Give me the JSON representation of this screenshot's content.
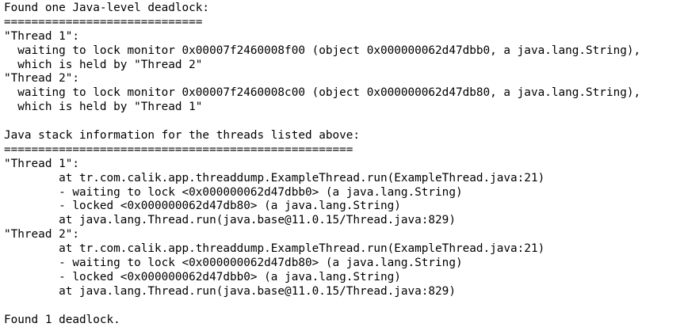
{
  "terminal": {
    "lines": [
      "Found one Java-level deadlock:",
      "=============================",
      "\"Thread 1\":",
      "  waiting to lock monitor 0x00007f2460008f00 (object 0x000000062d47dbb0, a java.lang.String),",
      "  which is held by \"Thread 2\"",
      "\"Thread 2\":",
      "  waiting to lock monitor 0x00007f2460008c00 (object 0x000000062d47db80, a java.lang.String),",
      "  which is held by \"Thread 1\"",
      "",
      "Java stack information for the threads listed above:",
      "===================================================",
      "\"Thread 1\":",
      "        at tr.com.calik.app.threaddump.ExampleThread.run(ExampleThread.java:21)",
      "        - waiting to lock <0x000000062d47dbb0> (a java.lang.String)",
      "        - locked <0x000000062d47db80> (a java.lang.String)",
      "        at java.lang.Thread.run(java.base@11.0.15/Thread.java:829)",
      "\"Thread 2\":",
      "        at tr.com.calik.app.threaddump.ExampleThread.run(ExampleThread.java:21)",
      "        - waiting to lock <0x000000062d47db80> (a java.lang.String)",
      "        - locked <0x000000062d47dbb0> (a java.lang.String)",
      "        at java.lang.Thread.run(java.base@11.0.15/Thread.java:829)",
      "",
      "Found 1 deadlock."
    ]
  }
}
